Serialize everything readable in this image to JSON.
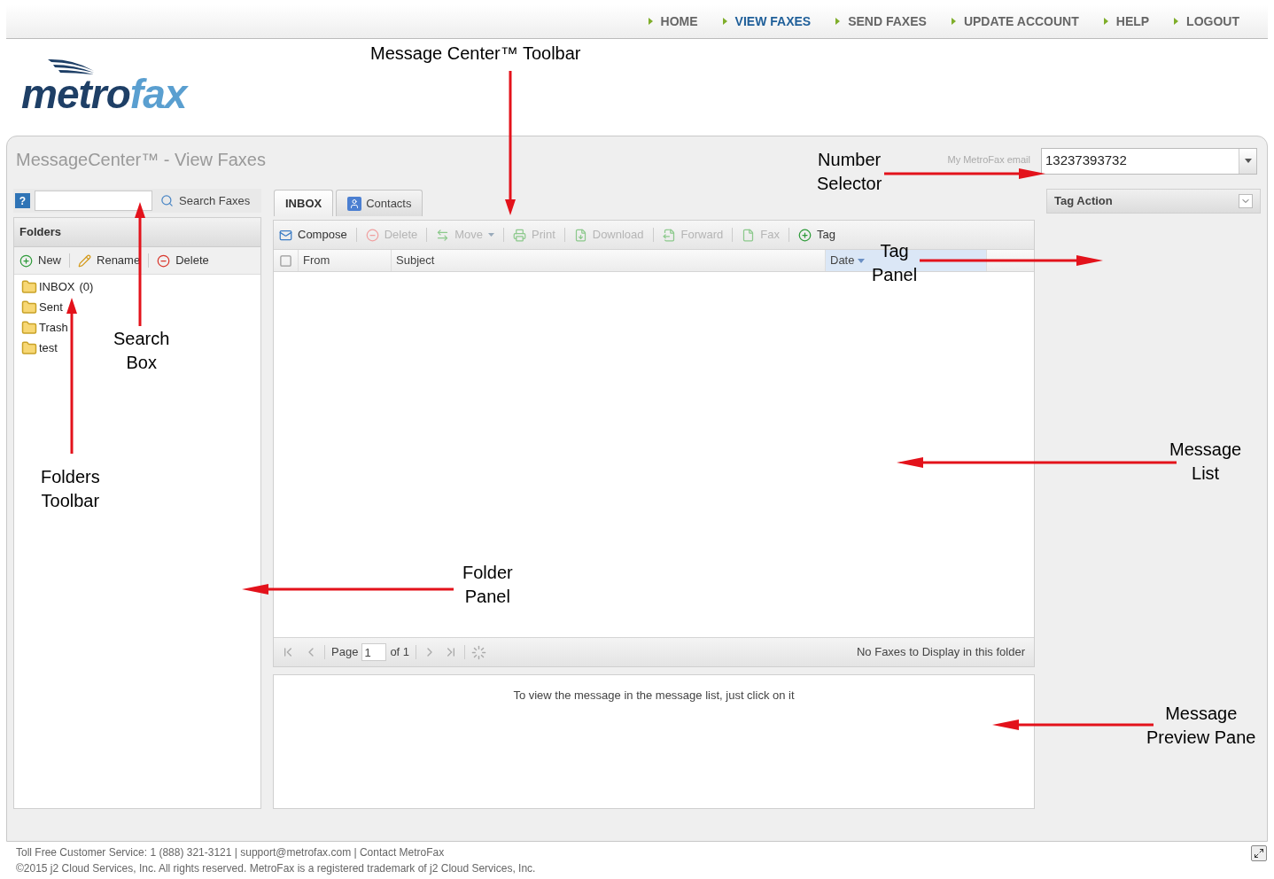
{
  "nav": [
    {
      "label": "HOME",
      "selected": false
    },
    {
      "label": "VIEW FAXES",
      "selected": true
    },
    {
      "label": "SEND FAXES",
      "selected": false
    },
    {
      "label": "UPDATE ACCOUNT",
      "selected": false
    },
    {
      "label": "HELP",
      "selected": false
    },
    {
      "label": "LOGOUT",
      "selected": false
    }
  ],
  "logo": {
    "first": "metro",
    "second": "fax"
  },
  "window": {
    "title": "MessageCenter™ - View Faxes"
  },
  "number_selector": {
    "label": "My MetroFax email",
    "value": "13237393732"
  },
  "search": {
    "help": "?",
    "button": "Search Faxes"
  },
  "folders": {
    "title": "Folders",
    "toolbar": [
      {
        "label": "New",
        "kind": "add"
      },
      {
        "label": "Rename",
        "kind": "rename"
      },
      {
        "label": "Delete",
        "kind": "delete"
      }
    ],
    "items": [
      {
        "label": "INBOX",
        "count": "(0)"
      },
      {
        "label": "Sent"
      },
      {
        "label": "Trash"
      },
      {
        "label": "test"
      }
    ]
  },
  "tabs": [
    {
      "label": "INBOX",
      "selected": true,
      "kind": "inbox"
    },
    {
      "label": "Contacts",
      "selected": false,
      "kind": "contacts"
    }
  ],
  "toolbar": [
    {
      "label": "Compose",
      "kind": "compose",
      "disabled": false
    },
    {
      "label": "Delete",
      "kind": "delete",
      "disabled": true
    },
    {
      "label": "Move",
      "kind": "move",
      "disabled": true
    },
    {
      "label": "Print",
      "kind": "print",
      "disabled": true
    },
    {
      "label": "Download",
      "kind": "download",
      "disabled": true
    },
    {
      "label": "Forward",
      "kind": "forward",
      "disabled": true
    },
    {
      "label": "Fax",
      "kind": "fax",
      "disabled": true
    },
    {
      "label": "Tag",
      "kind": "tag",
      "disabled": false
    }
  ],
  "table": {
    "select_all": {
      "checked": false
    },
    "columns": [
      {
        "label": "From",
        "sorted": false
      },
      {
        "label": "Subject",
        "sorted": false
      },
      {
        "label": "Date",
        "sorted": true
      }
    ]
  },
  "paging": {
    "page_label": "Page",
    "page": "1",
    "of": "of 1",
    "status": "No Faxes to Display in this folder"
  },
  "preview": {
    "text": "To view the message in the message list, just click on it"
  },
  "tag_panel": {
    "title": "Tag Action"
  },
  "footer": {
    "line1": "Toll Free Customer Service: 1 (888) 321-3121 | support@metrofax.com | Contact MetroFax",
    "line2": "©2015 j2 Cloud Services, Inc. All rights reserved. MetroFax is a registered trademark of j2 Cloud Services, Inc."
  },
  "annotations": [
    {
      "text": "Message Center™ Toolbar"
    },
    {
      "text": "Number\nSelector"
    },
    {
      "text": "Tag\nPanel"
    },
    {
      "text": "Search\nBox"
    },
    {
      "text": "Folders\nToolbar"
    },
    {
      "text": "Folder\nPanel"
    },
    {
      "text": "Message\nList"
    },
    {
      "text": "Message\nPreview Pane"
    }
  ]
}
